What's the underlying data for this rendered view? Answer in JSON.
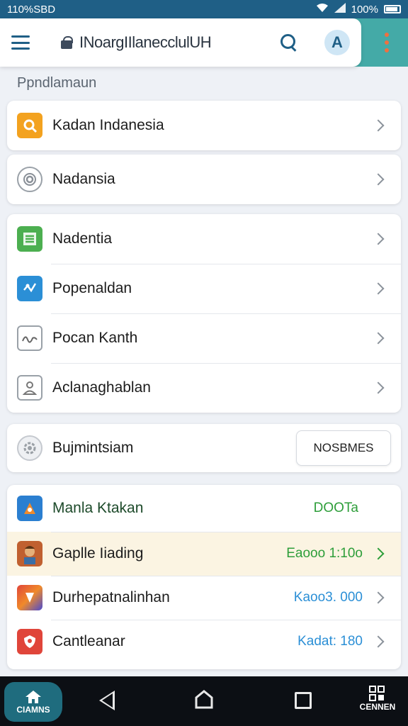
{
  "status_bar": {
    "time": "110%SBD",
    "battery": "100%"
  },
  "app_bar": {
    "title": "INoargIIlanecclulUH",
    "avatar_letter": "A"
  },
  "section_header": "Ppndlamaun",
  "group1": [
    {
      "label": "Kadan Indanesia",
      "icon": "phone-icon",
      "color": "#f3a21f"
    }
  ],
  "group2": [
    {
      "label": "Nadansia",
      "icon": "at-sign-icon",
      "color": "#ffffff"
    }
  ],
  "group3": [
    {
      "label": "Nadentia",
      "icon": "document-list-icon",
      "color": "#4caf50"
    },
    {
      "label": "Popenaldan",
      "icon": "share-icon",
      "color": "#2b8fd6"
    },
    {
      "label": "Pocan Kanth",
      "icon": "signature-icon",
      "color": "#ffffff"
    },
    {
      "label": "Aclanaghablan",
      "icon": "person-icon",
      "color": "#ffffff"
    }
  ],
  "group4": {
    "label": "Bujmintsiam",
    "icon": "gear-icon",
    "button_label": "NOSBMES"
  },
  "group5": [
    {
      "label": "Manla Ktakan",
      "value": "DOOTa",
      "value_color": "#2e9e3a",
      "icon": "app-icon",
      "color": "#2b7fd0"
    },
    {
      "label": "Gaplle Iiading",
      "value": "Eaooo 1:10o",
      "value_color": "#2e9e3a",
      "icon": "profile-photo-icon",
      "color": "#c06030"
    },
    {
      "label": "Durhepatnalinhan",
      "value": "Kaoo3. 000",
      "value_color": "#2b8fd6",
      "icon": "app-icon",
      "color": "#e0453a"
    },
    {
      "label": "Cantleanar",
      "value": "Kadat: 180",
      "value_color": "#2b8fd6",
      "icon": "shield-icon",
      "color": "#e0453a"
    }
  ],
  "nav": {
    "home_label": "CIAMNS",
    "more_label": "CENNEN"
  }
}
